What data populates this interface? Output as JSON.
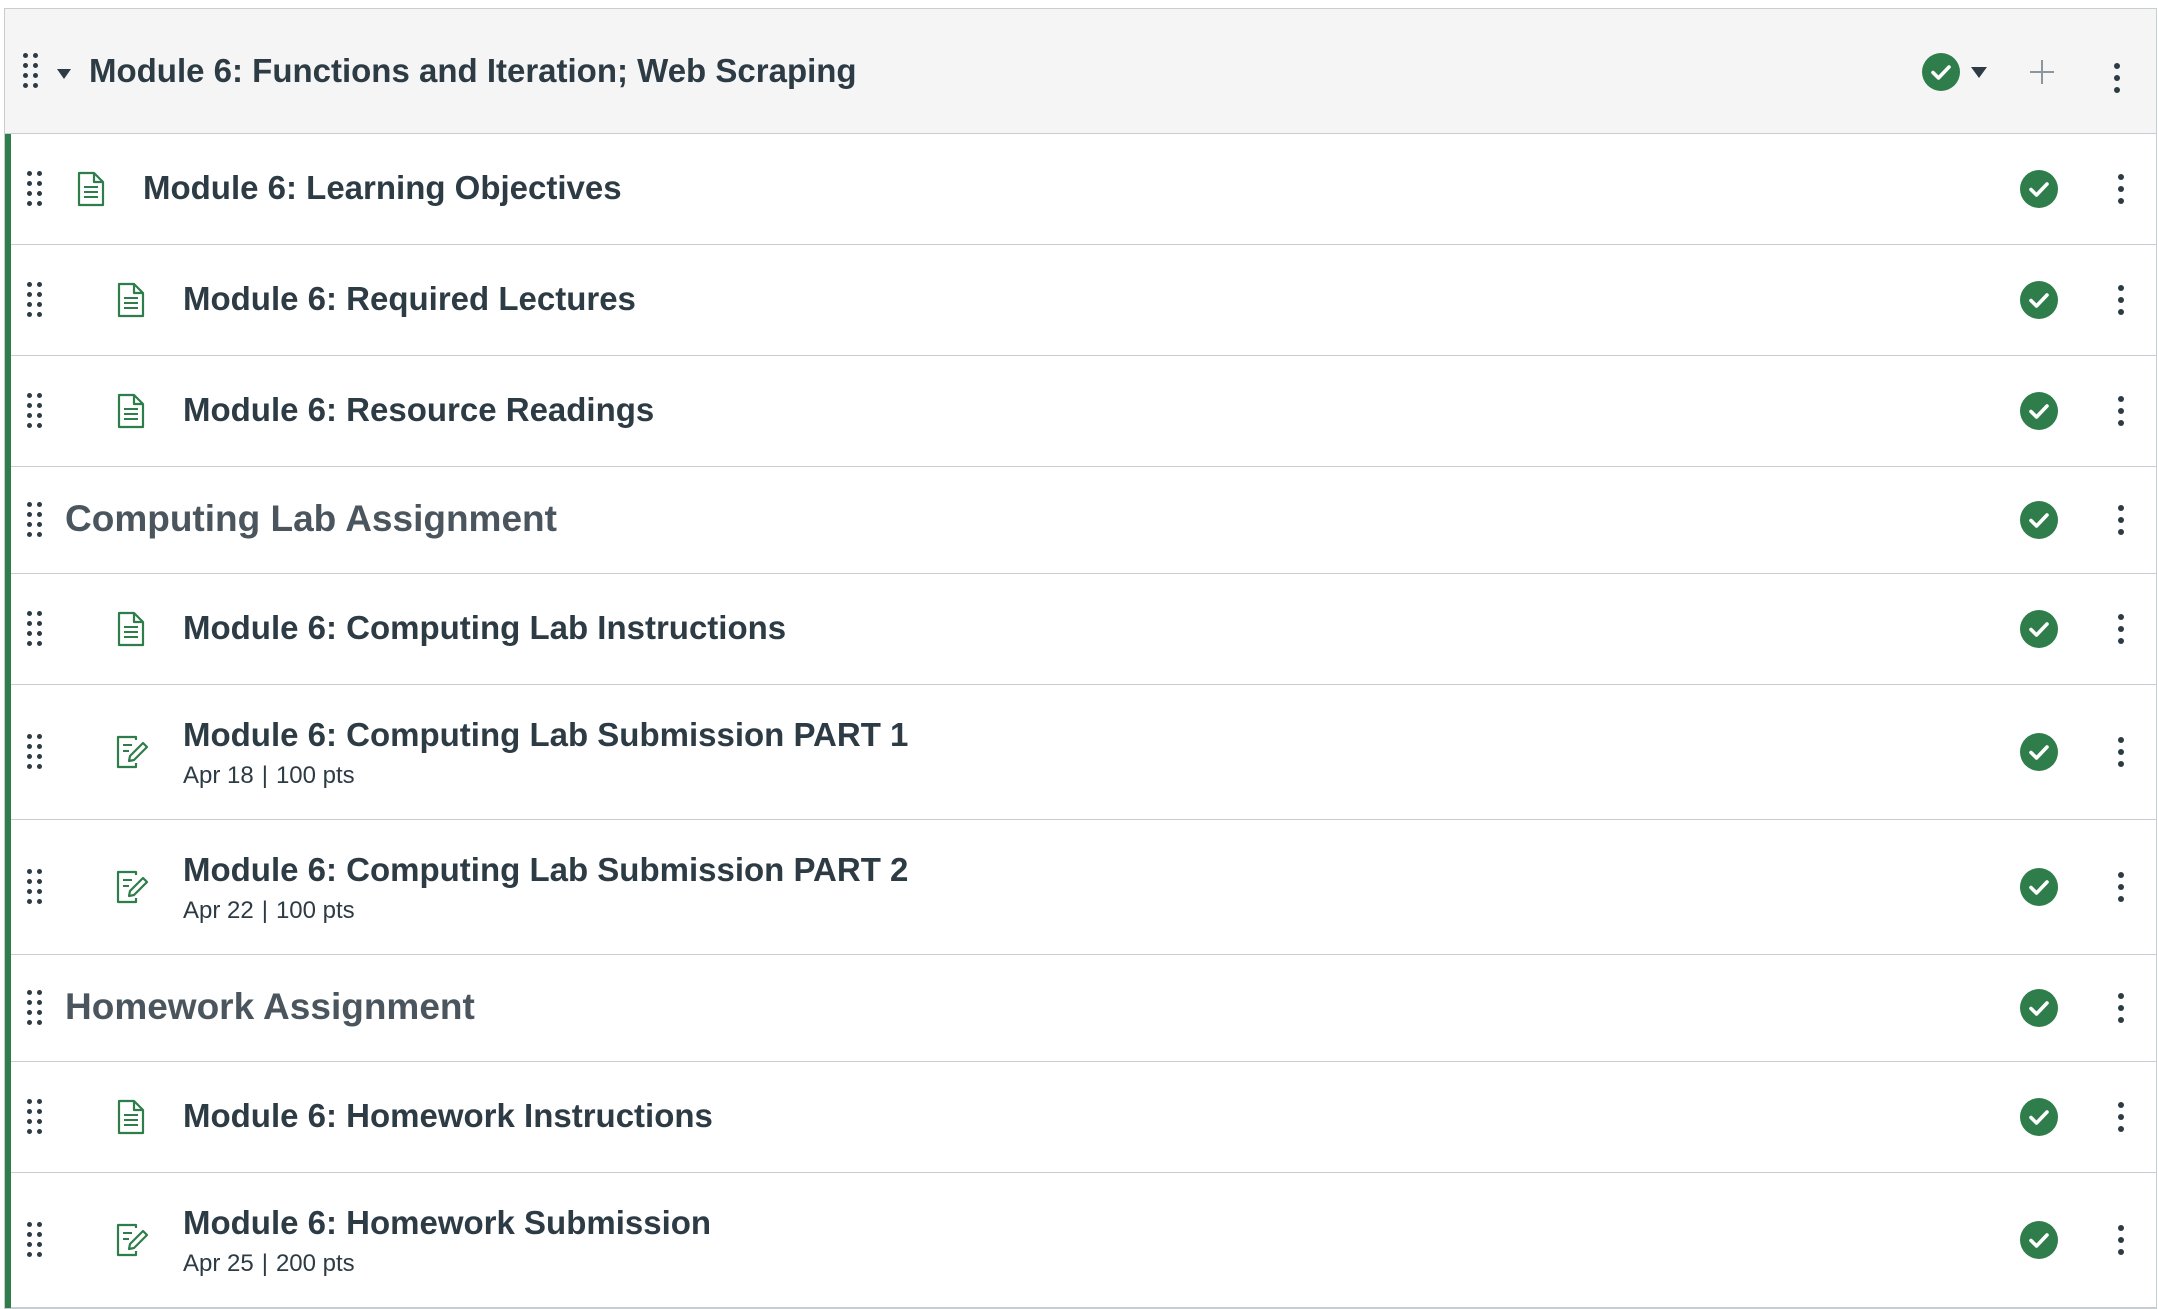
{
  "module": {
    "title": "Module 6: Functions and Iteration; Web Scraping",
    "accent_color": "#2e7d4a",
    "published": true
  },
  "items": [
    {
      "type": "page",
      "title": "Module 6: Learning Objectives",
      "published": true
    },
    {
      "type": "page",
      "title": "Module 6: Required Lectures",
      "published": true
    },
    {
      "type": "page",
      "title": "Module 6: Resource Readings",
      "published": true
    },
    {
      "type": "subheader",
      "title": "Computing Lab Assignment",
      "published": true
    },
    {
      "type": "page",
      "title": "Module 6: Computing Lab Instructions",
      "published": true
    },
    {
      "type": "assignment",
      "title": "Module 6: Computing Lab Submission PART 1",
      "due": "Apr 18",
      "points": "100 pts",
      "published": true
    },
    {
      "type": "assignment",
      "title": "Module 6: Computing Lab Submission PART 2",
      "due": "Apr 22",
      "points": "100 pts",
      "published": true
    },
    {
      "type": "subheader",
      "title": "Homework Assignment",
      "published": true
    },
    {
      "type": "page",
      "title": "Module 6: Homework Instructions",
      "published": true
    },
    {
      "type": "assignment",
      "title": "Module 6: Homework Submission",
      "due": "Apr 25",
      "points": "200 pts",
      "published": true
    }
  ],
  "meta_separator": "|",
  "icons": {
    "drag": "drag-handle-icon",
    "page": "document-icon",
    "assignment": "assignment-icon",
    "published": "published-check-icon",
    "menu": "kebab-menu-icon",
    "add": "plus-icon"
  }
}
